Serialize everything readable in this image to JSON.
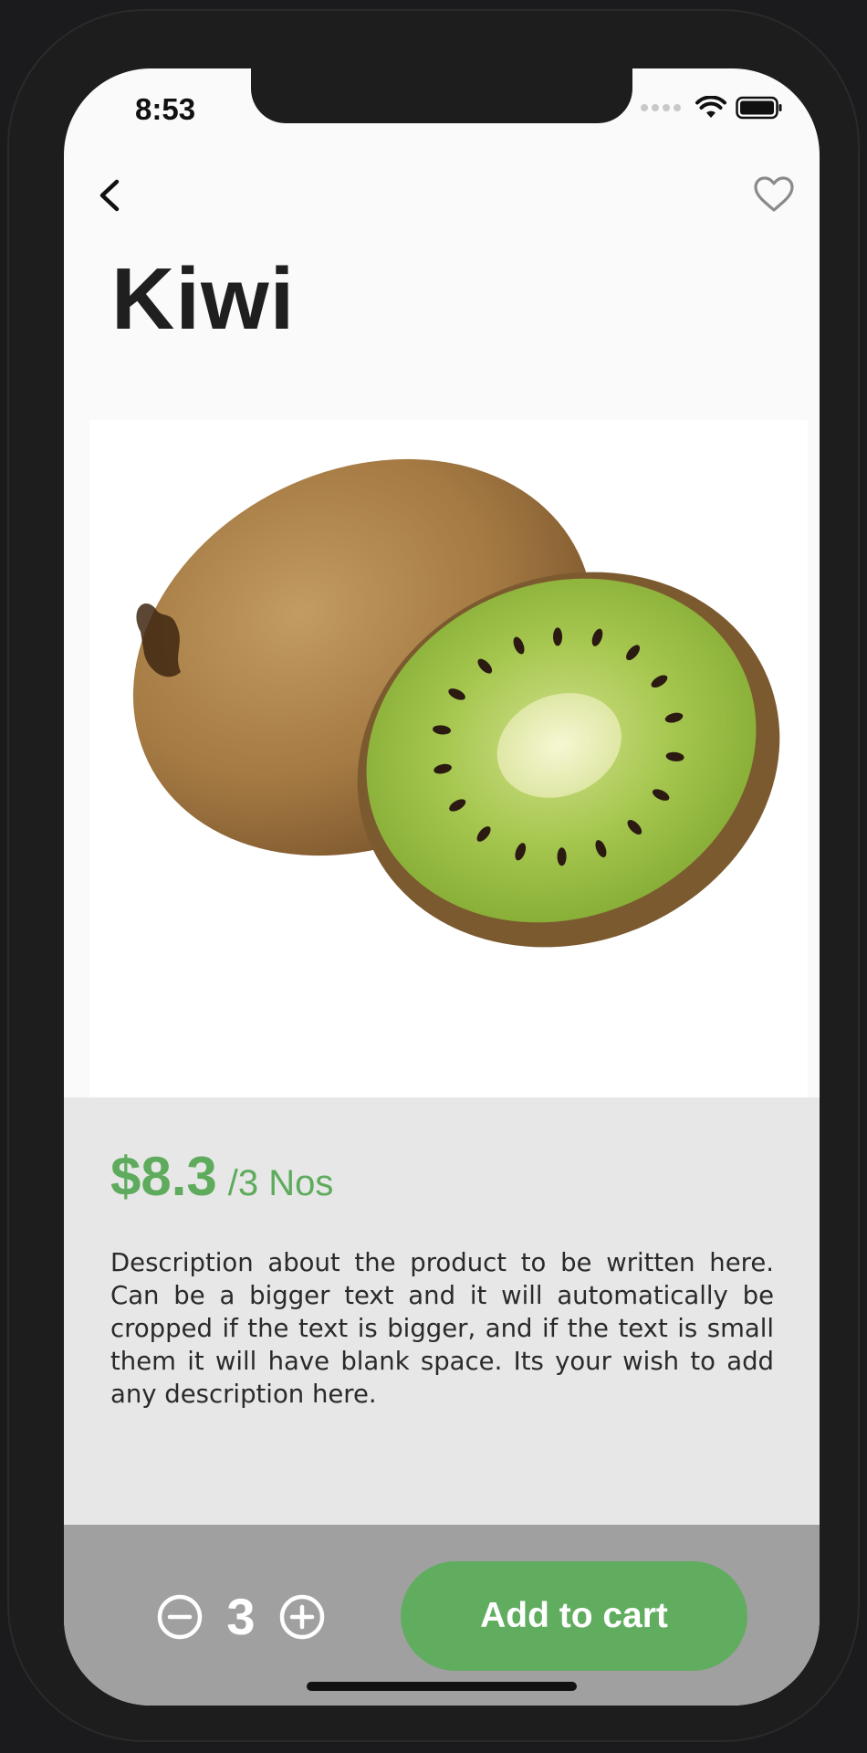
{
  "status_bar": {
    "time": "8:53"
  },
  "header": {
    "back_icon": "chevron-left-icon",
    "favorite_icon": "heart-outline-icon"
  },
  "product": {
    "name": "Kiwi",
    "price": "$8.3",
    "unit": "/3 Nos",
    "description": "Description about the product to be written here. Can be a bigger text and it will automatically be cropped if the text is bigger, and if the text is small them it will have blank space. Its your wish to add any description here."
  },
  "cart": {
    "quantity": "3",
    "add_label": "Add to cart",
    "decrement_icon": "minus-circle-icon",
    "increment_icon": "plus-circle-icon"
  },
  "colors": {
    "accent": "#61ad60",
    "price_text": "#5eab5d",
    "panel": "#e7e7e7",
    "bottom_bar": "#a0a0a0"
  }
}
